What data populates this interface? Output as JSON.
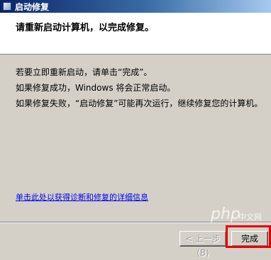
{
  "window": {
    "title": "启动修复"
  },
  "header": {
    "text": "请重新启动计算机，以完成修复。"
  },
  "messages": [
    "若要立即重新启动，请单击“完成”。",
    "如果修复成功，Windows 将会正常启动。",
    "如果修复失败，“启动修复”可能再次运行，继续修复您的计算机。"
  ],
  "details_link": "单击此处以获得诊断和修复的详细信息",
  "buttons": {
    "back": "< 上一步(B)",
    "finish": "完成"
  },
  "watermark": {
    "main": "php",
    "sub": "中文网"
  },
  "colors": {
    "highlight": "#e60000",
    "titlebar": "#0a246a"
  }
}
